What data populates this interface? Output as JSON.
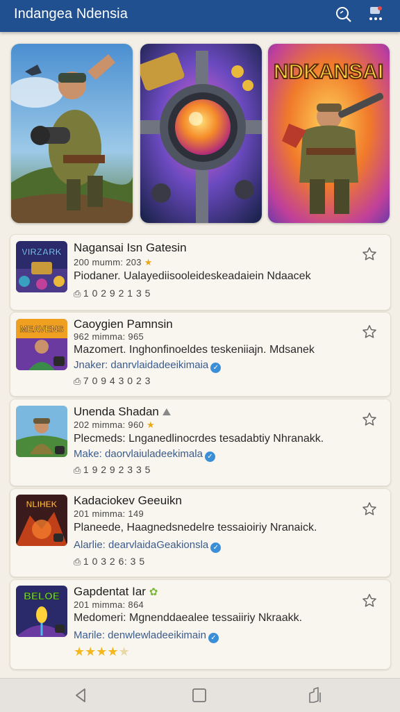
{
  "appbar": {
    "title": "Indangea Ndensia",
    "search_icon": "search-icon",
    "more_icon": "notification-more-icon",
    "color": "#20508f"
  },
  "banners": [
    {
      "name": "soldier-hero-banner"
    },
    {
      "name": "reactor-core-banner"
    },
    {
      "name": "ndkansai-banner",
      "label": "NDKANSAI"
    }
  ],
  "games": [
    {
      "thumb_label": "VIRZARK",
      "name": "Nagansai Isn Gatesin",
      "meta": "200 mumm: 203",
      "description": "Piodaner. Ualayediisooleideskeadaiein Ndaacek",
      "stats": "1 0 2 9  2 1 3 5"
    },
    {
      "thumb_label": "MEAVENS",
      "name": "Caoygien Pamnsin",
      "meta": "962 mimma: 965",
      "description": "Mazomert. Inghonfinoeldes teskeniiajn. Mdsanek",
      "maker": "Jnaker: danrvlaidadeeikimaia",
      "stats": "7 0 9 4  3 0 2 3"
    },
    {
      "name": "Unenda Shadan",
      "meta": "202 mimma: 960",
      "description": "Plecmeds: Lnganedlinocrdes tesadabtiy Nhranakk.",
      "maker": "Make: daorvlaiuladeekimala",
      "stats": "1 9 2 9  2 3 3 5"
    },
    {
      "thumb_label": "NLIHEK",
      "name": "Kadaciokev Geeuikn",
      "meta": "201 mimma: 149",
      "description": "Planeede, Haagnedsnedelre tessaioiriy Nranaick.",
      "maker": "Alarlie: dearvlaidaGeakionsla",
      "stats": "1 0 3  2 6: 3 5"
    },
    {
      "thumb_label": "BELOE",
      "name": "Gapdentat Iar",
      "meta": "201 mimma: 864",
      "description": "Medomeri: Mgnenddaealee tessaiiriy Nkraakk.",
      "maker": "Marile: denwlewladeeikimain",
      "rating": 4
    }
  ],
  "navbar": {
    "back_icon": "back-icon",
    "home_icon": "home-icon",
    "recents_icon": "recents-icon"
  }
}
